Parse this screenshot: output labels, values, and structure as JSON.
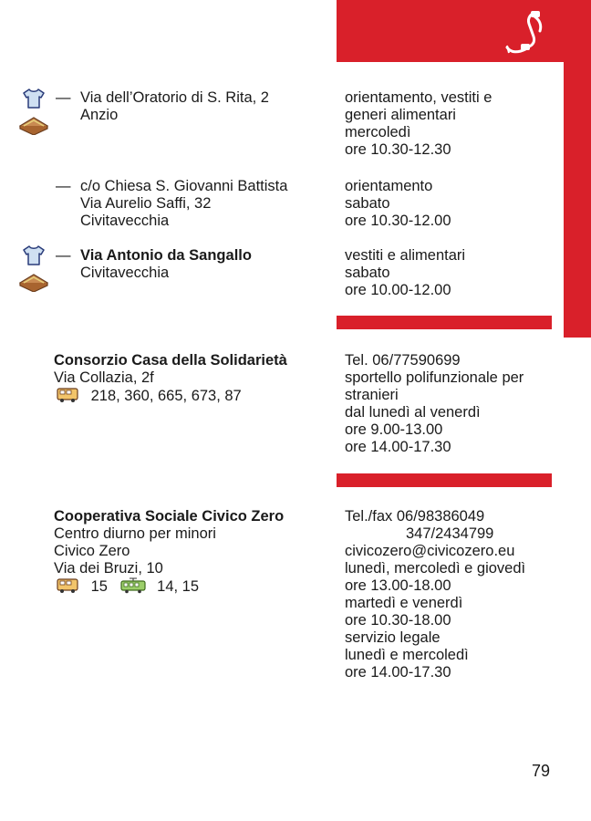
{
  "colors": {
    "accent": "#d9202a",
    "text": "#1a1a1a"
  },
  "header": {
    "icon": "telephone-icon"
  },
  "entries": [
    {
      "dash": "—",
      "icons": [
        "tshirt-icon",
        "sandwich-icon"
      ],
      "address": [
        "Via dell’Oratorio di S. Rita, 2",
        "Anzio"
      ],
      "info": [
        "orientamento, vestiti e",
        "generi alimentari",
        "mercoledì",
        "ore 10.30-12.30"
      ]
    },
    {
      "dash": "—",
      "icons": [],
      "address": [
        "c/o Chiesa S. Giovanni Battista",
        "Via Aurelio Saffi, 32",
        "Civitavecchia"
      ],
      "info": [
        "orientamento",
        "sabato",
        "ore 10.30-12.00"
      ]
    },
    {
      "dash": "—",
      "icons": [
        "tshirt-icon",
        "sandwich-icon"
      ],
      "address": [
        "Via Antonio da Sangallo",
        "Civitavecchia"
      ],
      "info": [
        "vestiti e alimentari",
        "sabato",
        "ore 10.00-12.00"
      ]
    }
  ],
  "orgs": [
    {
      "name": "Consorzio Casa della Solidarietà",
      "lines": [
        "Via Collazia, 2f"
      ],
      "transport": [
        {
          "icon": "bus-icon",
          "text": "218, 360, 665, 673, 87"
        }
      ],
      "contact": [
        "Tel. 06/77590699",
        "sportello polifunzionale per",
        "stranieri",
        "dal lunedì al venerdì",
        "ore 9.00-13.00",
        "ore 14.00-17.30"
      ]
    },
    {
      "name": "Cooperativa Sociale Civico Zero",
      "lines": [
        "Centro diurno per minori",
        "Civico Zero",
        "Via dei Bruzi, 10"
      ],
      "transport": [
        {
          "icon": "bus-icon",
          "text": "15"
        },
        {
          "icon": "tram-icon",
          "text": "14, 15"
        }
      ],
      "contact": [
        "Tel./fax 06/98386049",
        "347/2434799",
        "civicozero@civicozero.eu",
        "lunedì, mercoledì e giovedì",
        "ore 13.00-18.00",
        "martedì e venerdì",
        "ore 10.30-18.00",
        "servizio legale",
        "lunedì e mercoledì",
        "ore 14.00-17.30"
      ]
    }
  ],
  "page_number": "79"
}
